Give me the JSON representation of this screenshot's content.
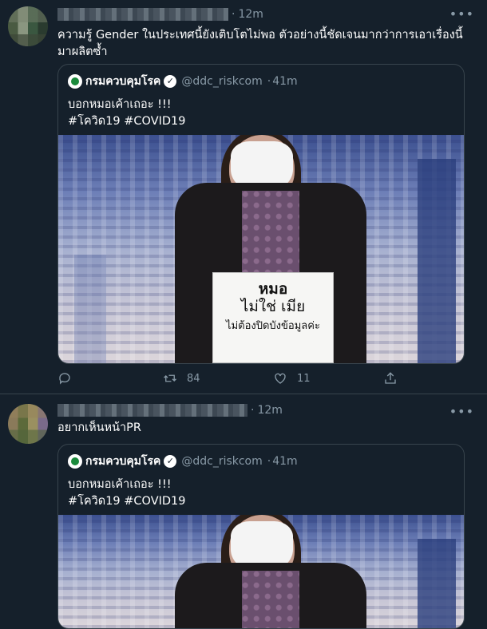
{
  "tweets": [
    {
      "time": "12m",
      "text": "ความรู้ Gender ในประเทศนี้ยังเติบโตไม่พอ ตัวอย่างนี้ชัดเจนมากว่าการเอาเรื่องนี้มาผลิตซ้ำ",
      "quote": {
        "name": "กรมควบคุมโรค",
        "handle": "@ddc_riskcom",
        "time": "41m",
        "text_line1": "บอกหมอเค้าเถอะ !!!",
        "text_line2": "#โควิด19 #COVID19",
        "sign": [
          "หมอ",
          "ไม่ใช่ เมีย",
          "ไม่ต้องปิดบังข้อมูลค่ะ"
        ]
      },
      "actions": {
        "retweets": "84",
        "likes": "11"
      }
    },
    {
      "time": "12m",
      "text": "อยากเห็นหน้าPR",
      "quote": {
        "name": "กรมควบคุมโรค",
        "handle": "@ddc_riskcom",
        "time": "41m",
        "text_line1": "บอกหมอเค้าเถอะ !!!",
        "text_line2": "#โควิด19 #COVID19"
      }
    }
  ],
  "ui": {
    "more": "•••",
    "separator": "·",
    "verified_mark": "✓"
  },
  "icons": [
    "reply-icon",
    "retweet-icon",
    "like-icon",
    "share-icon",
    "more-icon",
    "verified-icon"
  ],
  "colors": {
    "background": "#15202b",
    "border": "#38444d",
    "secondary_text": "#8899a6"
  }
}
